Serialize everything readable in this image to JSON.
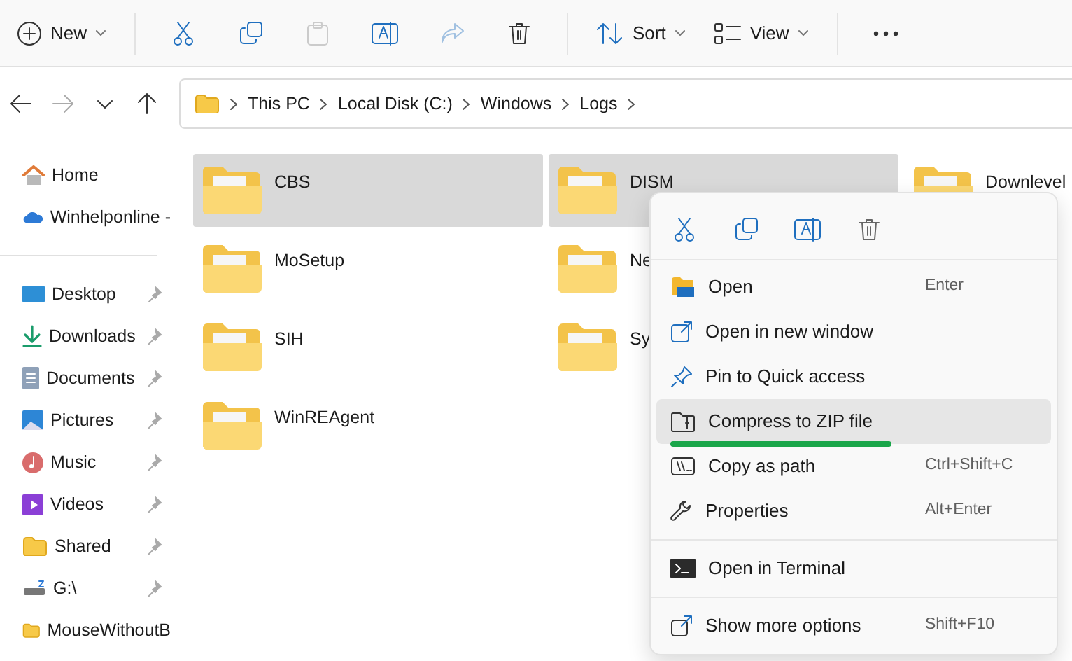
{
  "toolbar": {
    "items": [
      {
        "kind": "menu",
        "label": "New",
        "disabled": false
      },
      {
        "kind": "icon",
        "disabled": false
      },
      {
        "kind": "icon",
        "disabled": false
      },
      {
        "kind": "icon",
        "disabled": true
      },
      {
        "kind": "icon",
        "disabled": false
      },
      {
        "kind": "icon",
        "disabled": true
      },
      {
        "kind": "icon",
        "disabled": false
      },
      {
        "kind": "menu",
        "label": "Sort",
        "disabled": false
      },
      {
        "kind": "menu",
        "label": "View",
        "disabled": false
      },
      {
        "kind": "icon",
        "disabled": false
      }
    ]
  },
  "navigation": {
    "back_disabled": false,
    "forward_disabled": true
  },
  "breadcrumb": [
    "This PC",
    "Local Disk (C:)",
    "Windows",
    "Logs"
  ],
  "sidebar": {
    "top_items": [
      {
        "label": "Home",
        "pinned": false
      },
      {
        "label": "Winhelponline -",
        "pinned": false
      }
    ],
    "quick_access": [
      {
        "label": "Desktop",
        "pinned": true
      },
      {
        "label": "Downloads",
        "pinned": true
      },
      {
        "label": "Documents",
        "pinned": true
      },
      {
        "label": "Pictures",
        "pinned": true
      },
      {
        "label": "Music",
        "pinned": true
      },
      {
        "label": "Videos",
        "pinned": true
      },
      {
        "label": "Shared",
        "pinned": true
      },
      {
        "label": "G:\\",
        "pinned": true
      },
      {
        "label": "MouseWithoutB",
        "pinned": false
      }
    ]
  },
  "files": [
    {
      "name": "CBS",
      "selected": true
    },
    {
      "name": "DISM",
      "selected": true
    },
    {
      "name": "Downlevel",
      "selected": false
    },
    {
      "name": "MoSetup",
      "selected": false
    },
    {
      "name": "Ne",
      "selected": false
    },
    {
      "name": "SIH",
      "selected": false
    },
    {
      "name": "Sy",
      "selected": false
    },
    {
      "name": "WinREAgent",
      "selected": false
    }
  ],
  "context_menu": {
    "groups": [
      [
        {
          "label": "Open",
          "shortcut": "Enter",
          "highlighted": false,
          "underlined": false
        },
        {
          "label": "Open in new window",
          "highlighted": false,
          "underlined": false
        },
        {
          "label": "Pin to Quick access",
          "highlighted": false,
          "underlined": false
        },
        {
          "label": "Compress to ZIP file",
          "highlighted": true,
          "underlined": true
        },
        {
          "label": "Copy as path",
          "shortcut": "Ctrl+Shift+C",
          "highlighted": false,
          "underlined": false
        },
        {
          "label": "Properties",
          "shortcut": "Alt+Enter",
          "highlighted": false,
          "underlined": false
        }
      ],
      [
        {
          "label": "Open in Terminal",
          "highlighted": false,
          "underlined": false
        }
      ],
      [
        {
          "label": "Show more options",
          "shortcut": "Shift+F10",
          "highlighted": false,
          "underlined": false
        }
      ]
    ]
  }
}
